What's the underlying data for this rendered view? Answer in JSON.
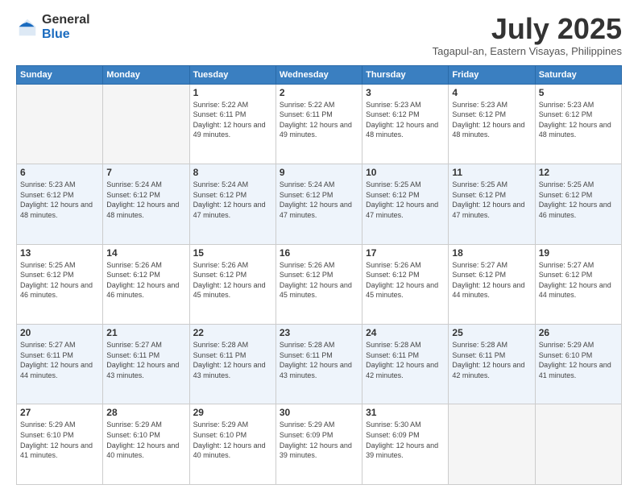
{
  "logo": {
    "general": "General",
    "blue": "Blue"
  },
  "header": {
    "month": "July 2025",
    "location": "Tagapul-an, Eastern Visayas, Philippines"
  },
  "weekdays": [
    "Sunday",
    "Monday",
    "Tuesday",
    "Wednesday",
    "Thursday",
    "Friday",
    "Saturday"
  ],
  "weeks": [
    [
      {
        "day": "",
        "info": ""
      },
      {
        "day": "",
        "info": ""
      },
      {
        "day": "1",
        "info": "Sunrise: 5:22 AM\nSunset: 6:11 PM\nDaylight: 12 hours and 49 minutes."
      },
      {
        "day": "2",
        "info": "Sunrise: 5:22 AM\nSunset: 6:11 PM\nDaylight: 12 hours and 49 minutes."
      },
      {
        "day": "3",
        "info": "Sunrise: 5:23 AM\nSunset: 6:12 PM\nDaylight: 12 hours and 48 minutes."
      },
      {
        "day": "4",
        "info": "Sunrise: 5:23 AM\nSunset: 6:12 PM\nDaylight: 12 hours and 48 minutes."
      },
      {
        "day": "5",
        "info": "Sunrise: 5:23 AM\nSunset: 6:12 PM\nDaylight: 12 hours and 48 minutes."
      }
    ],
    [
      {
        "day": "6",
        "info": "Sunrise: 5:23 AM\nSunset: 6:12 PM\nDaylight: 12 hours and 48 minutes."
      },
      {
        "day": "7",
        "info": "Sunrise: 5:24 AM\nSunset: 6:12 PM\nDaylight: 12 hours and 48 minutes."
      },
      {
        "day": "8",
        "info": "Sunrise: 5:24 AM\nSunset: 6:12 PM\nDaylight: 12 hours and 47 minutes."
      },
      {
        "day": "9",
        "info": "Sunrise: 5:24 AM\nSunset: 6:12 PM\nDaylight: 12 hours and 47 minutes."
      },
      {
        "day": "10",
        "info": "Sunrise: 5:25 AM\nSunset: 6:12 PM\nDaylight: 12 hours and 47 minutes."
      },
      {
        "day": "11",
        "info": "Sunrise: 5:25 AM\nSunset: 6:12 PM\nDaylight: 12 hours and 47 minutes."
      },
      {
        "day": "12",
        "info": "Sunrise: 5:25 AM\nSunset: 6:12 PM\nDaylight: 12 hours and 46 minutes."
      }
    ],
    [
      {
        "day": "13",
        "info": "Sunrise: 5:25 AM\nSunset: 6:12 PM\nDaylight: 12 hours and 46 minutes."
      },
      {
        "day": "14",
        "info": "Sunrise: 5:26 AM\nSunset: 6:12 PM\nDaylight: 12 hours and 46 minutes."
      },
      {
        "day": "15",
        "info": "Sunrise: 5:26 AM\nSunset: 6:12 PM\nDaylight: 12 hours and 45 minutes."
      },
      {
        "day": "16",
        "info": "Sunrise: 5:26 AM\nSunset: 6:12 PM\nDaylight: 12 hours and 45 minutes."
      },
      {
        "day": "17",
        "info": "Sunrise: 5:26 AM\nSunset: 6:12 PM\nDaylight: 12 hours and 45 minutes."
      },
      {
        "day": "18",
        "info": "Sunrise: 5:27 AM\nSunset: 6:12 PM\nDaylight: 12 hours and 44 minutes."
      },
      {
        "day": "19",
        "info": "Sunrise: 5:27 AM\nSunset: 6:12 PM\nDaylight: 12 hours and 44 minutes."
      }
    ],
    [
      {
        "day": "20",
        "info": "Sunrise: 5:27 AM\nSunset: 6:11 PM\nDaylight: 12 hours and 44 minutes."
      },
      {
        "day": "21",
        "info": "Sunrise: 5:27 AM\nSunset: 6:11 PM\nDaylight: 12 hours and 43 minutes."
      },
      {
        "day": "22",
        "info": "Sunrise: 5:28 AM\nSunset: 6:11 PM\nDaylight: 12 hours and 43 minutes."
      },
      {
        "day": "23",
        "info": "Sunrise: 5:28 AM\nSunset: 6:11 PM\nDaylight: 12 hours and 43 minutes."
      },
      {
        "day": "24",
        "info": "Sunrise: 5:28 AM\nSunset: 6:11 PM\nDaylight: 12 hours and 42 minutes."
      },
      {
        "day": "25",
        "info": "Sunrise: 5:28 AM\nSunset: 6:11 PM\nDaylight: 12 hours and 42 minutes."
      },
      {
        "day": "26",
        "info": "Sunrise: 5:29 AM\nSunset: 6:10 PM\nDaylight: 12 hours and 41 minutes."
      }
    ],
    [
      {
        "day": "27",
        "info": "Sunrise: 5:29 AM\nSunset: 6:10 PM\nDaylight: 12 hours and 41 minutes."
      },
      {
        "day": "28",
        "info": "Sunrise: 5:29 AM\nSunset: 6:10 PM\nDaylight: 12 hours and 40 minutes."
      },
      {
        "day": "29",
        "info": "Sunrise: 5:29 AM\nSunset: 6:10 PM\nDaylight: 12 hours and 40 minutes."
      },
      {
        "day": "30",
        "info": "Sunrise: 5:29 AM\nSunset: 6:09 PM\nDaylight: 12 hours and 39 minutes."
      },
      {
        "day": "31",
        "info": "Sunrise: 5:30 AM\nSunset: 6:09 PM\nDaylight: 12 hours and 39 minutes."
      },
      {
        "day": "",
        "info": ""
      },
      {
        "day": "",
        "info": ""
      }
    ]
  ]
}
